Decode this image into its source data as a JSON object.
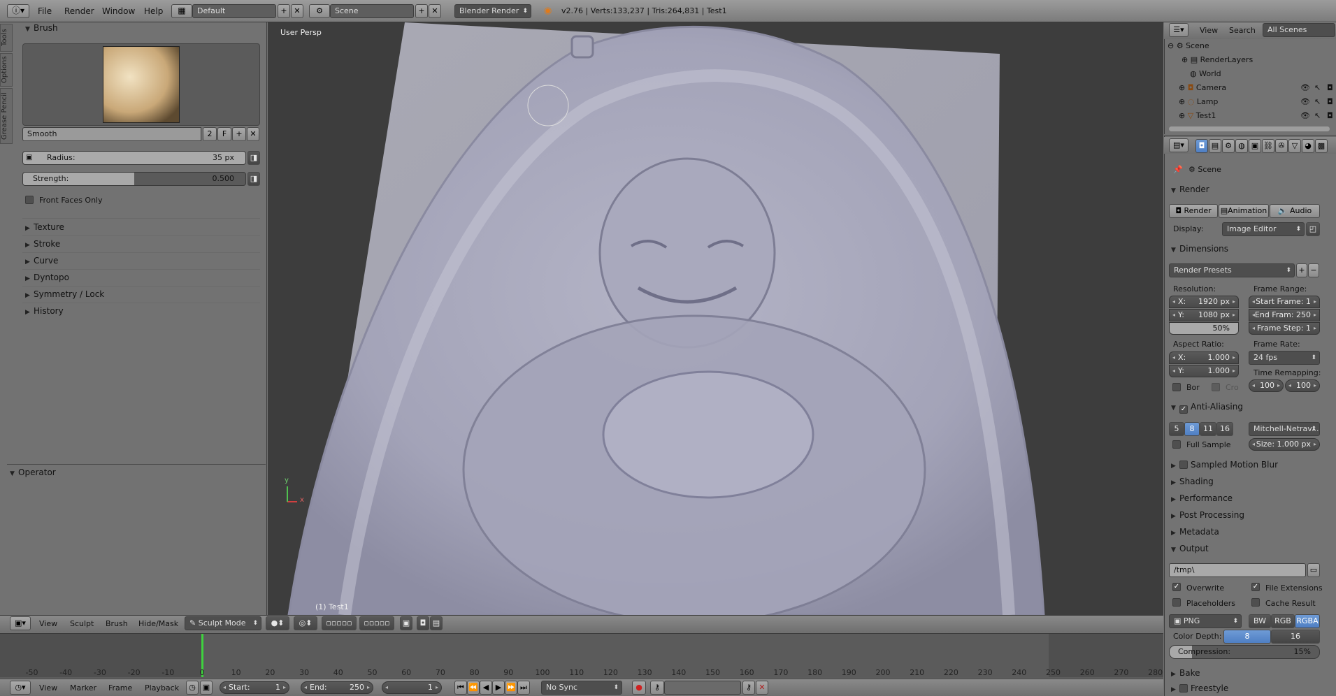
{
  "header": {
    "menus": [
      "File",
      "Render",
      "Window",
      "Help"
    ],
    "layout": "Default",
    "scene": "Scene",
    "engine": "Blender Render",
    "status": "v2.76 | Verts:133,237 | Tris:264,831 | Test1"
  },
  "tool_tabs": [
    "Tools",
    "Options",
    "Grease Pencil"
  ],
  "tool_shelf": {
    "brush_title": "Brush",
    "brush_name": "Smooth",
    "brush_users": "2",
    "brush_fake": "F",
    "radius_label": "Radius:",
    "radius_value": "35 px",
    "strength_label": "Strength:",
    "strength_value": "0.500",
    "strength_fraction": 0.5,
    "front_faces": "Front Faces Only",
    "sections": [
      "Texture",
      "Stroke",
      "Curve",
      "Dyntopo",
      "Symmetry / Lock",
      "History"
    ],
    "operator": "Operator"
  },
  "viewport": {
    "label": "User Persp",
    "object_label": "(1) Test1",
    "axis_x": "x",
    "axis_y": "y"
  },
  "viewport_header": {
    "menus": [
      "View",
      "Sculpt",
      "Brush",
      "Hide/Mask"
    ],
    "mode": "Sculpt Mode"
  },
  "timeline": {
    "ticks": [
      "-50",
      "-40",
      "-30",
      "-20",
      "-10",
      "0",
      "10",
      "20",
      "30",
      "40",
      "50",
      "60",
      "70",
      "80",
      "90",
      "100",
      "110",
      "120",
      "130",
      "140",
      "150",
      "160",
      "170",
      "180",
      "190",
      "200",
      "210",
      "220",
      "230",
      "240",
      "250",
      "260",
      "270",
      "280"
    ],
    "menus": [
      "View",
      "Marker",
      "Frame",
      "Playback"
    ],
    "start_label": "Start:",
    "start_value": "1",
    "end_label": "End:",
    "end_value": "250",
    "current": "1",
    "sync": "No Sync"
  },
  "outliner": {
    "menus": [
      "View",
      "Search"
    ],
    "filter": "All Scenes",
    "items": [
      "Scene",
      "RenderLayers",
      "World",
      "Camera",
      "Lamp",
      "Test1"
    ]
  },
  "properties": {
    "breadcrumb": "Scene",
    "render_panel": "Render",
    "render_btn": "Render",
    "animation_btn": "Animation",
    "audio_btn": "Audio",
    "display_label": "Display:",
    "display_value": "Image Editor",
    "dimensions": "Dimensions",
    "presets": "Render Presets",
    "resolution_label": "Resolution:",
    "res_x_label": "X:",
    "res_x": "1920 px",
    "res_y_label": "Y:",
    "res_y": "1080 px",
    "res_pct": "50%",
    "frame_range_label": "Frame Range:",
    "start_frame": "Start Frame: 1",
    "end_frame": "End Fram: 250",
    "frame_step": "Frame Step: 1",
    "aspect_label": "Aspect Ratio:",
    "aspect_x_label": "X:",
    "aspect_x": "1.000",
    "aspect_y_label": "Y:",
    "aspect_y": "1.000",
    "frame_rate_label": "Frame Rate:",
    "frame_rate": "24 fps",
    "remap_label": "Time Remapping:",
    "remap_old": "100",
    "remap_new": "100",
    "border": "Bor",
    "crop": "Cro",
    "aa": "Anti-Aliasing",
    "aa_samples": [
      "5",
      "8",
      "11",
      "16"
    ],
    "aa_filter": "Mitchell-Netrav...",
    "full_sample": "Full Sample",
    "aa_size": "Size: 1.000 px",
    "collapsed": [
      "Sampled Motion Blur",
      "Shading",
      "Performance",
      "Post Processing",
      "Metadata"
    ],
    "output": "Output",
    "path": "/tmp\\",
    "overwrite": "Overwrite",
    "file_ext": "File Extensions",
    "placeholders": "Placeholders",
    "cache": "Cache Result",
    "format": "PNG",
    "bw": "BW",
    "rgb": "RGB",
    "rgba": "RGBA",
    "depth_label": "Color Depth:",
    "depth_8": "8",
    "depth_16": "16",
    "compression_label": "Compression:",
    "compression": "15%",
    "compression_fraction": 0.15,
    "bake": "Bake",
    "freestyle": "Freestyle"
  }
}
